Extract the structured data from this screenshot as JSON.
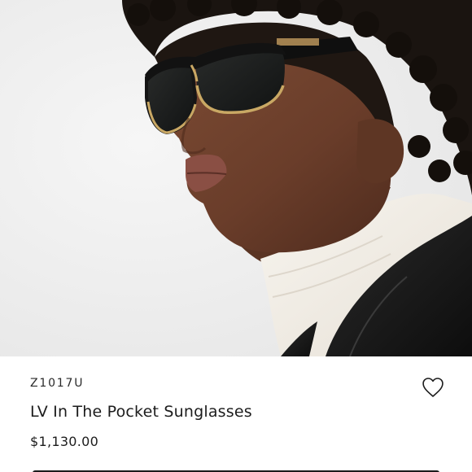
{
  "product": {
    "sku": "Z1017U",
    "name": "LV In The Pocket Sunglasses",
    "price": "$1,130.00"
  },
  "hero": {
    "icon": "product-photo",
    "description_visible": false
  },
  "wishlist": {
    "icon": "heart-outline-icon"
  },
  "colors": {
    "background": "#ffffff",
    "text": "#1c1c1c",
    "hero_bg": "#eeeeee"
  }
}
